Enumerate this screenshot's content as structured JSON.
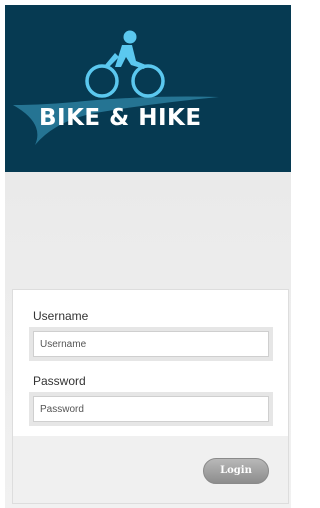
{
  "header": {
    "brand_text": "BIKE & HIKE",
    "logo_icon": "cyclist-icon",
    "background_color": "#063a52",
    "accent_color": "#5bc8ef"
  },
  "login_form": {
    "username_label": "Username",
    "username_placeholder": "Username",
    "username_value": "",
    "password_label": "Password",
    "password_placeholder": "Password",
    "password_value": "",
    "login_button_label": "Login"
  }
}
